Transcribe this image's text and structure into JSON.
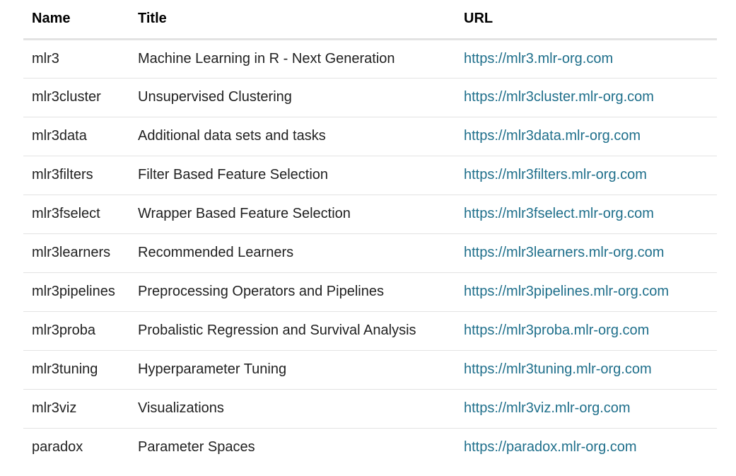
{
  "table": {
    "headers": {
      "name": "Name",
      "title": "Title",
      "url": "URL"
    },
    "rows": [
      {
        "name": "mlr3",
        "title": "Machine Learning in R - Next Generation",
        "url": "https://mlr3.mlr-org.com"
      },
      {
        "name": "mlr3cluster",
        "title": "Unsupervised Clustering",
        "url": "https://mlr3cluster.mlr-org.com"
      },
      {
        "name": "mlr3data",
        "title": "Additional data sets and tasks",
        "url": "https://mlr3data.mlr-org.com"
      },
      {
        "name": "mlr3filters",
        "title": "Filter Based Feature Selection",
        "url": "https://mlr3filters.mlr-org.com"
      },
      {
        "name": "mlr3fselect",
        "title": "Wrapper Based Feature Selection",
        "url": "https://mlr3fselect.mlr-org.com"
      },
      {
        "name": "mlr3learners",
        "title": "Recommended Learners",
        "url": "https://mlr3learners.mlr-org.com"
      },
      {
        "name": "mlr3pipelines",
        "title": "Preprocessing Operators and Pipelines",
        "url": "https://mlr3pipelines.mlr-org.com"
      },
      {
        "name": "mlr3proba",
        "title": "Probalistic Regression and Survival Analysis",
        "url": "https://mlr3proba.mlr-org.com"
      },
      {
        "name": "mlr3tuning",
        "title": "Hyperparameter Tuning",
        "url": "https://mlr3tuning.mlr-org.com"
      },
      {
        "name": "mlr3viz",
        "title": "Visualizations",
        "url": "https://mlr3viz.mlr-org.com"
      },
      {
        "name": "paradox",
        "title": "Parameter Spaces",
        "url": "https://paradox.mlr-org.com"
      }
    ]
  },
  "colors": {
    "link": "#1f6f8b",
    "divider": "#e3e3e3",
    "text": "#212121"
  }
}
